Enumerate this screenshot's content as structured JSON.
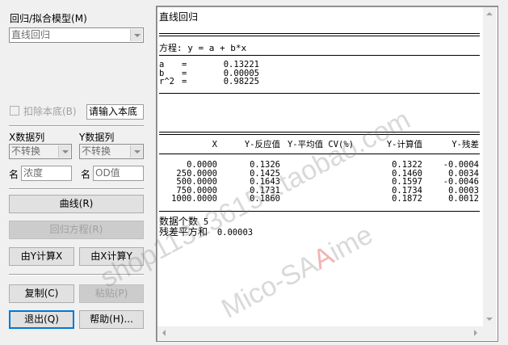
{
  "left_panel": {
    "model_label": "回归/拟合模型(M)",
    "model_value": "直线回归",
    "subtract_blank_label": "扣除本底(B)",
    "blank_placeholder": "请输入本底",
    "x_col_label": "X数据列",
    "y_col_label": "Y数据列",
    "x_transform": "不转换",
    "y_transform": "不转换",
    "x_name_label": "名",
    "y_name_label": "名",
    "x_name_value": "浓度",
    "y_name_value": "OD值",
    "buttons": {
      "curve": "曲线(R)",
      "equation": "回归方程(R)",
      "calc_x": "由Y计算X",
      "calc_y": "由X计算Y",
      "copy": "复制(C)",
      "paste": "粘贴(P)",
      "exit": "退出(Q)",
      "help": "帮助(H)..."
    }
  },
  "output": {
    "title": "直线回归",
    "equation": "方程: y = a + b*x",
    "params": [
      {
        "name": "a",
        "eq": "=",
        "value": "0.13221"
      },
      {
        "name": "b",
        "eq": "=",
        "value": "0.00005"
      },
      {
        "name": "r^2",
        "eq": "=",
        "value": "0.98225"
      }
    ],
    "table": {
      "headers": [
        "X",
        "Y-反应值",
        "Y-平均值 CV(%)",
        "Y-计算值",
        "Y-残差"
      ],
      "rows": [
        [
          "0.0000",
          "0.1326",
          "",
          "0.1322",
          "-0.0004"
        ],
        [
          "250.0000",
          "0.1425",
          "",
          "0.1460",
          "0.0034"
        ],
        [
          "500.0000",
          "0.1643",
          "",
          "0.1597",
          "-0.0046"
        ],
        [
          "750.0000",
          "0.1731",
          "",
          "0.1734",
          "0.0003"
        ],
        [
          "1000.0000",
          "0.1860",
          "",
          "0.1872",
          "0.0012"
        ]
      ]
    },
    "count_label": "数据个数",
    "count_value": "5",
    "rss_label": "残差平方和",
    "rss_value": "0.00003"
  },
  "watermarks": {
    "line1": "shop113136155.taobao.com",
    "line2_a": "Mico-SA",
    "line2_b": "A",
    "line2_c": "ime"
  }
}
